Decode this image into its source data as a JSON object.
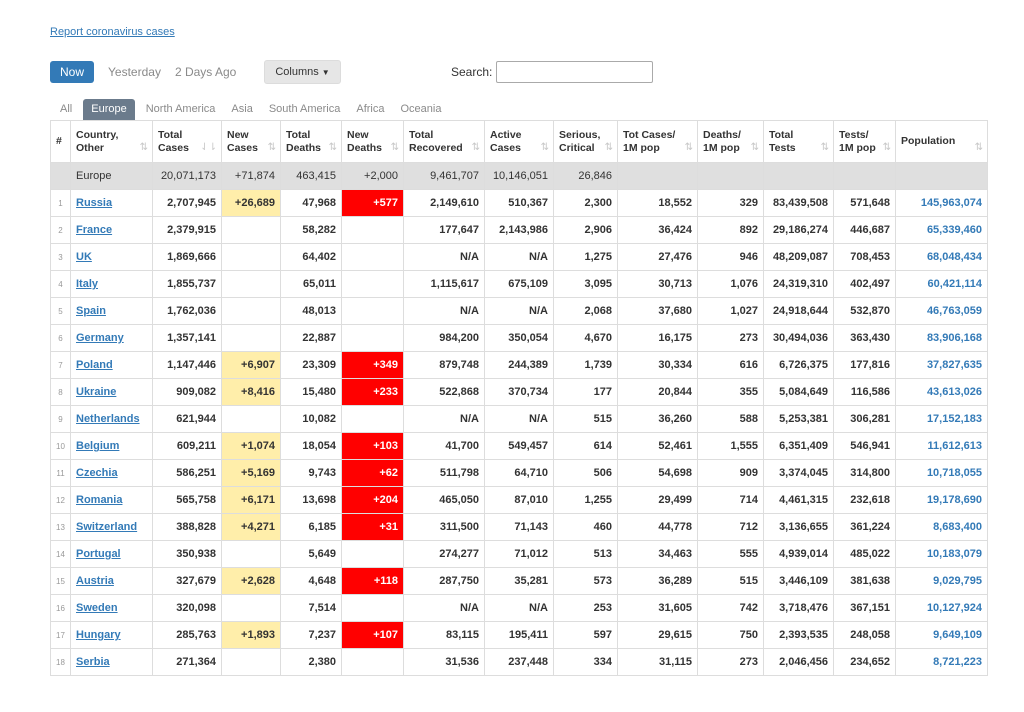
{
  "report_link": "Report coronavirus cases",
  "toolbar": {
    "now": "Now",
    "yesterday": "Yesterday",
    "two_days_ago": "2 Days Ago",
    "columns": "Columns",
    "search_label": "Search:",
    "search_value": ""
  },
  "tabs": [
    "All",
    "Europe",
    "North America",
    "Asia",
    "South America",
    "Africa",
    "Oceania"
  ],
  "active_tab": "Europe",
  "headers": [
    [
      "#"
    ],
    [
      "Country,",
      "Other"
    ],
    [
      "Total",
      "Cases"
    ],
    [
      "New",
      "Cases"
    ],
    [
      "Total",
      "Deaths"
    ],
    [
      "New",
      "Deaths"
    ],
    [
      "Total",
      "Recovered"
    ],
    [
      "Active",
      "Cases"
    ],
    [
      "Serious,",
      "Critical"
    ],
    [
      "Tot Cases/",
      "1M pop"
    ],
    [
      "Deaths/",
      "1M pop"
    ],
    [
      "Total",
      "Tests"
    ],
    [
      "Tests/",
      "1M pop"
    ],
    [
      "Population"
    ]
  ],
  "total_row": {
    "country": "Europe",
    "total_cases": "20,071,173",
    "new_cases": "+71,874",
    "total_deaths": "463,415",
    "new_deaths": "+2,000",
    "total_recovered": "9,461,707",
    "active_cases": "10,146,051",
    "serious": "26,846",
    "cases_per_1m": "",
    "deaths_per_1m": "",
    "total_tests": "",
    "tests_per_1m": "",
    "population": ""
  },
  "rows": [
    {
      "num": "1",
      "country": "Russia",
      "total_cases": "2,707,945",
      "new_cases": "+26,689",
      "total_deaths": "47,968",
      "new_deaths": "+577",
      "total_recovered": "2,149,610",
      "active_cases": "510,367",
      "serious": "2,300",
      "cases_per_1m": "18,552",
      "deaths_per_1m": "329",
      "total_tests": "83,439,508",
      "tests_per_1m": "571,648",
      "population": "145,963,074"
    },
    {
      "num": "2",
      "country": "France",
      "total_cases": "2,379,915",
      "new_cases": "",
      "total_deaths": "58,282",
      "new_deaths": "",
      "total_recovered": "177,647",
      "active_cases": "2,143,986",
      "serious": "2,906",
      "cases_per_1m": "36,424",
      "deaths_per_1m": "892",
      "total_tests": "29,186,274",
      "tests_per_1m": "446,687",
      "population": "65,339,460"
    },
    {
      "num": "3",
      "country": "UK",
      "total_cases": "1,869,666",
      "new_cases": "",
      "total_deaths": "64,402",
      "new_deaths": "",
      "total_recovered": "N/A",
      "active_cases": "N/A",
      "serious": "1,275",
      "cases_per_1m": "27,476",
      "deaths_per_1m": "946",
      "total_tests": "48,209,087",
      "tests_per_1m": "708,453",
      "population": "68,048,434"
    },
    {
      "num": "4",
      "country": "Italy",
      "total_cases": "1,855,737",
      "new_cases": "",
      "total_deaths": "65,011",
      "new_deaths": "",
      "total_recovered": "1,115,617",
      "active_cases": "675,109",
      "serious": "3,095",
      "cases_per_1m": "30,713",
      "deaths_per_1m": "1,076",
      "total_tests": "24,319,310",
      "tests_per_1m": "402,497",
      "population": "60,421,114"
    },
    {
      "num": "5",
      "country": "Spain",
      "total_cases": "1,762,036",
      "new_cases": "",
      "total_deaths": "48,013",
      "new_deaths": "",
      "total_recovered": "N/A",
      "active_cases": "N/A",
      "serious": "2,068",
      "cases_per_1m": "37,680",
      "deaths_per_1m": "1,027",
      "total_tests": "24,918,644",
      "tests_per_1m": "532,870",
      "population": "46,763,059"
    },
    {
      "num": "6",
      "country": "Germany",
      "total_cases": "1,357,141",
      "new_cases": "",
      "total_deaths": "22,887",
      "new_deaths": "",
      "total_recovered": "984,200",
      "active_cases": "350,054",
      "serious": "4,670",
      "cases_per_1m": "16,175",
      "deaths_per_1m": "273",
      "total_tests": "30,494,036",
      "tests_per_1m": "363,430",
      "population": "83,906,168"
    },
    {
      "num": "7",
      "country": "Poland",
      "total_cases": "1,147,446",
      "new_cases": "+6,907",
      "total_deaths": "23,309",
      "new_deaths": "+349",
      "total_recovered": "879,748",
      "active_cases": "244,389",
      "serious": "1,739",
      "cases_per_1m": "30,334",
      "deaths_per_1m": "616",
      "total_tests": "6,726,375",
      "tests_per_1m": "177,816",
      "population": "37,827,635"
    },
    {
      "num": "8",
      "country": "Ukraine",
      "total_cases": "909,082",
      "new_cases": "+8,416",
      "total_deaths": "15,480",
      "new_deaths": "+233",
      "total_recovered": "522,868",
      "active_cases": "370,734",
      "serious": "177",
      "cases_per_1m": "20,844",
      "deaths_per_1m": "355",
      "total_tests": "5,084,649",
      "tests_per_1m": "116,586",
      "population": "43,613,026"
    },
    {
      "num": "9",
      "country": "Netherlands",
      "total_cases": "621,944",
      "new_cases": "",
      "total_deaths": "10,082",
      "new_deaths": "",
      "total_recovered": "N/A",
      "active_cases": "N/A",
      "serious": "515",
      "cases_per_1m": "36,260",
      "deaths_per_1m": "588",
      "total_tests": "5,253,381",
      "tests_per_1m": "306,281",
      "population": "17,152,183"
    },
    {
      "num": "10",
      "country": "Belgium",
      "total_cases": "609,211",
      "new_cases": "+1,074",
      "total_deaths": "18,054",
      "new_deaths": "+103",
      "total_recovered": "41,700",
      "active_cases": "549,457",
      "serious": "614",
      "cases_per_1m": "52,461",
      "deaths_per_1m": "1,555",
      "total_tests": "6,351,409",
      "tests_per_1m": "546,941",
      "population": "11,612,613"
    },
    {
      "num": "11",
      "country": "Czechia",
      "total_cases": "586,251",
      "new_cases": "+5,169",
      "total_deaths": "9,743",
      "new_deaths": "+62",
      "total_recovered": "511,798",
      "active_cases": "64,710",
      "serious": "506",
      "cases_per_1m": "54,698",
      "deaths_per_1m": "909",
      "total_tests": "3,374,045",
      "tests_per_1m": "314,800",
      "population": "10,718,055"
    },
    {
      "num": "12",
      "country": "Romania",
      "total_cases": "565,758",
      "new_cases": "+6,171",
      "total_deaths": "13,698",
      "new_deaths": "+204",
      "total_recovered": "465,050",
      "active_cases": "87,010",
      "serious": "1,255",
      "cases_per_1m": "29,499",
      "deaths_per_1m": "714",
      "total_tests": "4,461,315",
      "tests_per_1m": "232,618",
      "population": "19,178,690"
    },
    {
      "num": "13",
      "country": "Switzerland",
      "total_cases": "388,828",
      "new_cases": "+4,271",
      "total_deaths": "6,185",
      "new_deaths": "+31",
      "total_recovered": "311,500",
      "active_cases": "71,143",
      "serious": "460",
      "cases_per_1m": "44,778",
      "deaths_per_1m": "712",
      "total_tests": "3,136,655",
      "tests_per_1m": "361,224",
      "population": "8,683,400"
    },
    {
      "num": "14",
      "country": "Portugal",
      "total_cases": "350,938",
      "new_cases": "",
      "total_deaths": "5,649",
      "new_deaths": "",
      "total_recovered": "274,277",
      "active_cases": "71,012",
      "serious": "513",
      "cases_per_1m": "34,463",
      "deaths_per_1m": "555",
      "total_tests": "4,939,014",
      "tests_per_1m": "485,022",
      "population": "10,183,079"
    },
    {
      "num": "15",
      "country": "Austria",
      "total_cases": "327,679",
      "new_cases": "+2,628",
      "total_deaths": "4,648",
      "new_deaths": "+118",
      "total_recovered": "287,750",
      "active_cases": "35,281",
      "serious": "573",
      "cases_per_1m": "36,289",
      "deaths_per_1m": "515",
      "total_tests": "3,446,109",
      "tests_per_1m": "381,638",
      "population": "9,029,795"
    },
    {
      "num": "16",
      "country": "Sweden",
      "total_cases": "320,098",
      "new_cases": "",
      "total_deaths": "7,514",
      "new_deaths": "",
      "total_recovered": "N/A",
      "active_cases": "N/A",
      "serious": "253",
      "cases_per_1m": "31,605",
      "deaths_per_1m": "742",
      "total_tests": "3,718,476",
      "tests_per_1m": "367,151",
      "population": "10,127,924"
    },
    {
      "num": "17",
      "country": "Hungary",
      "total_cases": "285,763",
      "new_cases": "+1,893",
      "total_deaths": "7,237",
      "new_deaths": "+107",
      "total_recovered": "83,115",
      "active_cases": "195,411",
      "serious": "597",
      "cases_per_1m": "29,615",
      "deaths_per_1m": "750",
      "total_tests": "2,393,535",
      "tests_per_1m": "248,058",
      "population": "9,649,109"
    },
    {
      "num": "18",
      "country": "Serbia",
      "total_cases": "271,364",
      "new_cases": "",
      "total_deaths": "2,380",
      "new_deaths": "",
      "total_recovered": "31,536",
      "active_cases": "237,448",
      "serious": "334",
      "cases_per_1m": "31,115",
      "deaths_per_1m": "273",
      "total_tests": "2,046,456",
      "tests_per_1m": "234,652",
      "population": "8,721,223"
    }
  ],
  "colors": {
    "accent": "#337ab7",
    "new_cases_highlight": "#ffeeaa",
    "new_deaths_highlight": "#ff0000",
    "total_row_bg": "#dfdfdf",
    "active_tab_bg": "#6b7b8c"
  }
}
